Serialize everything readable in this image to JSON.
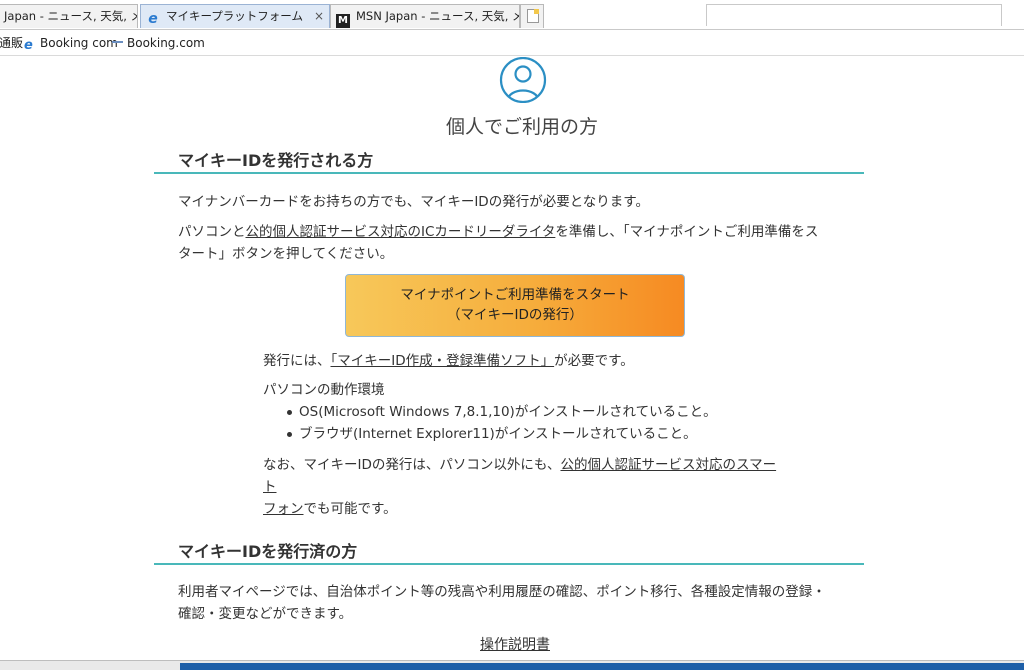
{
  "tabs": [
    {
      "label": "Japan - ニュース, 天気, メー...",
      "icon": "msn-icon",
      "active": false
    },
    {
      "label": "マイキープラットフォーム",
      "icon": "ie-icon",
      "active": true,
      "close": "×"
    },
    {
      "label": "MSN Japan - ニュース, 天気, メー...",
      "icon": "msn-icon",
      "active": false
    }
  ],
  "favorites": [
    {
      "label": "通販"
    },
    {
      "label": "Booking com",
      "icon": "ie-icon"
    },
    {
      "label": "Booking.com",
      "icon": "dash-icon"
    }
  ],
  "page": {
    "personal_title": "個人でご利用の方",
    "section1": {
      "heading": "マイキーIDを発行される方",
      "para1": "マイナンバーカードをお持ちの方でも、マイキーIDの発行が必要となります。",
      "para2_pre": "パソコンと",
      "para2_link": "公的個人認証サービス対応のICカードリーダライタ",
      "para2_post1": "を準備し、「マイナポイントご利用準備をス",
      "para2_post2": "タート」ボタンを押してください。",
      "start_button_line1": "マイナポイントご利用準備をスタート",
      "start_button_line2": "（マイキーIDの発行）",
      "issue_pre": "発行には、",
      "issue_link": "「マイキーID作成・登録準備ソフト」",
      "issue_post": "が必要です。",
      "env_title": "パソコンの動作環境",
      "env_items": [
        "OS(Microsoft Windows 7,8.1,10)がインストールされていること。",
        "ブラウザ(Internet Explorer11)がインストールされていること。"
      ],
      "note_pre": "なお、マイキーIDの発行は、パソコン以外にも、",
      "note_link1": "公的個人認証サービス対応のスマート",
      "note_link2": "フォン",
      "note_post": "でも可能です。"
    },
    "section2": {
      "heading": "マイキーIDを発行済の方",
      "para_line1": "利用者マイページでは、自治体ポイント等の残高や利用履歴の確認、ポイント移行、各種設定情報の登録・",
      "para_line2": "確認・変更などができます。",
      "manual_link": "操作説明書"
    }
  },
  "colors": {
    "accent_teal": "#49b8ba",
    "button_gradient_start": "#f7c85a",
    "button_gradient_end": "#f68a22",
    "user_icon": "#2b8fc4"
  }
}
